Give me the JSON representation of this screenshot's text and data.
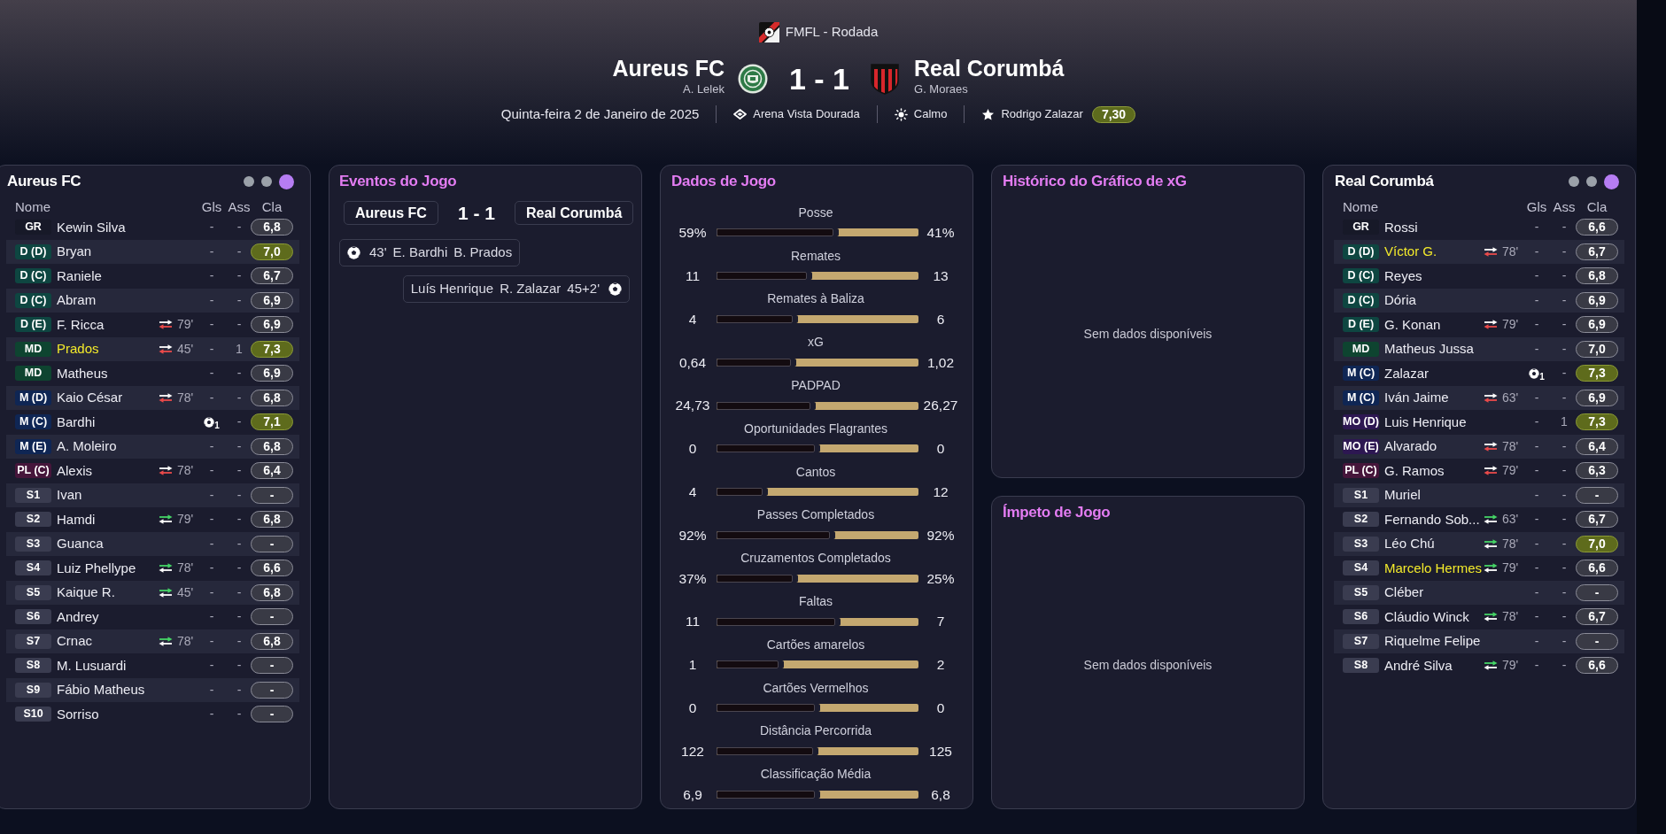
{
  "header": {
    "competition": "FMFL - Rodada",
    "home": {
      "name": "Aureus FC",
      "manager": "A. Lelek"
    },
    "score": "1 - 1",
    "away": {
      "name": "Real Corumbá",
      "manager": "G. Moraes"
    },
    "date": "Quinta-feira 2 de Janeiro de 2025",
    "stadium": "Arena Vista Dourada",
    "weather": "Calmo",
    "player_of_the_match": {
      "name": "Rodrigo Zalazar",
      "rating": "7,30"
    }
  },
  "home_lineup": {
    "title": "Aureus FC",
    "view_dots": [
      {
        "selected": false
      },
      {
        "selected": false
      },
      {
        "selected": true
      }
    ],
    "columns": [
      "Nome",
      "Gls",
      "Ass",
      "Cla"
    ],
    "players": [
      {
        "position": "GR",
        "color": "#171928",
        "name": "Kewin Silva",
        "highlighted": false,
        "goals": "-",
        "goal_icon": false,
        "assists": "-",
        "rating": "6,8",
        "top_rating": false
      },
      {
        "position": "D (D)",
        "color": "#0e4641",
        "name": "Bryan",
        "highlighted": false,
        "goals": "-",
        "goal_icon": false,
        "assists": "-",
        "rating": "7,0",
        "top_rating": true
      },
      {
        "position": "D (C)",
        "color": "#0e4641",
        "name": "Raniele",
        "highlighted": false,
        "goals": "-",
        "goal_icon": false,
        "assists": "-",
        "rating": "6,7",
        "top_rating": false
      },
      {
        "position": "D (C)",
        "color": "#0e4641",
        "name": "Abram",
        "highlighted": false,
        "goals": "-",
        "goal_icon": false,
        "assists": "-",
        "rating": "6,9",
        "top_rating": false
      },
      {
        "position": "D (E)",
        "color": "#0e4641",
        "name": "F. Ricca",
        "highlighted": false,
        "sub": {
          "kind": "off",
          "minute": "79'"
        },
        "goals": "-",
        "goal_icon": false,
        "assists": "-",
        "rating": "6,9",
        "top_rating": false
      },
      {
        "position": "MD",
        "color": "#0e4430",
        "name": "Prados",
        "highlighted": true,
        "sub": {
          "kind": "off",
          "minute": "45'"
        },
        "goals": "-",
        "goal_icon": false,
        "assists": "1",
        "rating": "7,3",
        "top_rating": true
      },
      {
        "position": "MD",
        "color": "#0e4430",
        "name": "Matheus",
        "highlighted": false,
        "goals": "-",
        "goal_icon": false,
        "assists": "-",
        "rating": "6,9",
        "top_rating": false
      },
      {
        "position": "M (D)",
        "color": "#0f2654",
        "name": "Kaio César",
        "highlighted": false,
        "sub": {
          "kind": "off",
          "minute": "78'"
        },
        "goals": "-",
        "goal_icon": false,
        "assists": "-",
        "rating": "6,8",
        "top_rating": false
      },
      {
        "position": "M (C)",
        "color": "#0f2654",
        "name": "Bardhi",
        "highlighted": false,
        "goals": "1",
        "goal_icon": true,
        "assists": "-",
        "rating": "7,1",
        "top_rating": true
      },
      {
        "position": "M (E)",
        "color": "#0f2654",
        "name": "A. Moleiro",
        "highlighted": false,
        "goals": "-",
        "goal_icon": false,
        "assists": "-",
        "rating": "6,8",
        "top_rating": false
      },
      {
        "position": "PL (C)",
        "color": "#46163b",
        "name": "Alexis",
        "highlighted": false,
        "sub": {
          "kind": "off",
          "minute": "78'"
        },
        "goals": "-",
        "goal_icon": false,
        "assists": "-",
        "rating": "6,4",
        "top_rating": false
      },
      {
        "position": "S1",
        "color": "#3a3c50",
        "name": "Ivan",
        "highlighted": false,
        "goals": "-",
        "goal_icon": false,
        "assists": "-",
        "rating": "-",
        "top_rating": false
      },
      {
        "position": "S2",
        "color": "#3a3c50",
        "name": "Hamdi",
        "highlighted": false,
        "sub": {
          "kind": "on",
          "minute": "79'"
        },
        "goals": "-",
        "goal_icon": false,
        "assists": "-",
        "rating": "6,8",
        "top_rating": false
      },
      {
        "position": "S3",
        "color": "#3a3c50",
        "name": "Guanca",
        "highlighted": false,
        "goals": "-",
        "goal_icon": false,
        "assists": "-",
        "rating": "-",
        "top_rating": false
      },
      {
        "position": "S4",
        "color": "#3a3c50",
        "name": "Luiz Phellype",
        "highlighted": false,
        "sub": {
          "kind": "on",
          "minute": "78'"
        },
        "goals": "-",
        "goal_icon": false,
        "assists": "-",
        "rating": "6,6",
        "top_rating": false
      },
      {
        "position": "S5",
        "color": "#3a3c50",
        "name": "Kaique R.",
        "highlighted": false,
        "sub": {
          "kind": "on",
          "minute": "45'"
        },
        "goals": "-",
        "goal_icon": false,
        "assists": "-",
        "rating": "6,8",
        "top_rating": false
      },
      {
        "position": "S6",
        "color": "#3a3c50",
        "name": "Andrey",
        "highlighted": false,
        "goals": "-",
        "goal_icon": false,
        "assists": "-",
        "rating": "-",
        "top_rating": false
      },
      {
        "position": "S7",
        "color": "#3a3c50",
        "name": "Crnac",
        "highlighted": false,
        "sub": {
          "kind": "on",
          "minute": "78'"
        },
        "goals": "-",
        "goal_icon": false,
        "assists": "-",
        "rating": "6,8",
        "top_rating": false
      },
      {
        "position": "S8",
        "color": "#3a3c50",
        "name": "M. Lusuardi",
        "highlighted": false,
        "goals": "-",
        "goal_icon": false,
        "assists": "-",
        "rating": "-",
        "top_rating": false
      },
      {
        "position": "S9",
        "color": "#3a3c50",
        "name": "Fábio Matheus",
        "highlighted": false,
        "goals": "-",
        "goal_icon": false,
        "assists": "-",
        "rating": "-",
        "top_rating": false
      },
      {
        "position": "S10",
        "color": "#3a3c50",
        "name": "Sorriso",
        "highlighted": false,
        "goals": "-",
        "goal_icon": false,
        "assists": "-",
        "rating": "-",
        "top_rating": false
      }
    ]
  },
  "events": {
    "title": "Eventos do Jogo",
    "home_team": "Aureus FC",
    "score": "1 - 1",
    "away_team": "Real Corumbá",
    "items": [
      {
        "kind": "goal",
        "right_aligned": false,
        "minute": "43'",
        "scorer": "E. Bardhi",
        "assist": "B. Prados"
      },
      {
        "kind": "goal",
        "right_aligned": true,
        "minute": "45+2'",
        "scorer": "R. Zalazar",
        "assist": "Luís Henrique"
      }
    ]
  },
  "match_stats": {
    "title": "Dados de Jogo",
    "stats": [
      {
        "label": "Posse",
        "home": "59%",
        "away": "41%",
        "level": 0.59
      },
      {
        "label": "Remates",
        "home": "11",
        "away": "13",
        "level": 0.46
      },
      {
        "label": "Remates à Baliza",
        "home": "4",
        "away": "6",
        "level": 0.39
      },
      {
        "label": "xG",
        "home": "0,64",
        "away": "1,02",
        "level": 0.38
      },
      {
        "label": "PADPAD",
        "home": "24,73",
        "away": "26,27",
        "level": 0.48
      },
      {
        "label": "Oportunidades Flagrantes",
        "home": "0",
        "away": "0",
        "level": 0.5
      },
      {
        "label": "Cantos",
        "home": "4",
        "away": "12",
        "level": 0.24
      },
      {
        "label": "Passes Completados",
        "home": "92%",
        "away": "92%",
        "level": 0.575
      },
      {
        "label": "Cruzamentos Completados",
        "home": "37%",
        "away": "25%",
        "level": 0.39
      },
      {
        "label": "Faltas",
        "home": "11",
        "away": "7",
        "level": 0.6
      },
      {
        "label": "Cartões amarelos",
        "home": "1",
        "away": "2",
        "level": 0.32
      },
      {
        "label": "Cartões Vermelhos",
        "home": "0",
        "away": "0",
        "level": 0.5
      },
      {
        "label": "Distância Percorrida",
        "home": "122",
        "away": "125",
        "level": 0.49
      },
      {
        "label": "Classificação Média",
        "home": "6,9",
        "away": "6,8",
        "level": 0.5
      }
    ]
  },
  "xg_history": {
    "title": "Histórico do Gráfico de xG",
    "empty_text": "Sem dados disponíveis"
  },
  "momentum": {
    "title": "Ímpeto de Jogo",
    "empty_text": "Sem dados disponíveis"
  },
  "away_lineup": {
    "title": "Real Corumbá",
    "view_dots": [
      {
        "selected": false
      },
      {
        "selected": false
      },
      {
        "selected": true
      }
    ],
    "columns": [
      "Nome",
      "Gls",
      "Ass",
      "Cla"
    ],
    "players": [
      {
        "position": "GR",
        "color": "#171928",
        "name": "Rossi",
        "highlighted": false,
        "goals": "-",
        "goal_icon": false,
        "assists": "-",
        "rating": "6,6",
        "top_rating": false
      },
      {
        "position": "D (D)",
        "color": "#0e4641",
        "name": "Víctor G.",
        "highlighted": true,
        "sub": {
          "kind": "off",
          "minute": "78'"
        },
        "goals": "-",
        "goal_icon": false,
        "assists": "-",
        "rating": "6,7",
        "top_rating": false
      },
      {
        "position": "D (C)",
        "color": "#0e4641",
        "name": "Reyes",
        "highlighted": false,
        "goals": "-",
        "goal_icon": false,
        "assists": "-",
        "rating": "6,8",
        "top_rating": false
      },
      {
        "position": "D (C)",
        "color": "#0e4641",
        "name": "Dória",
        "highlighted": false,
        "goals": "-",
        "goal_icon": false,
        "assists": "-",
        "rating": "6,9",
        "top_rating": false
      },
      {
        "position": "D (E)",
        "color": "#0e4641",
        "name": "G. Konan",
        "highlighted": false,
        "sub": {
          "kind": "off",
          "minute": "79'"
        },
        "goals": "-",
        "goal_icon": false,
        "assists": "-",
        "rating": "6,9",
        "top_rating": false
      },
      {
        "position": "MD",
        "color": "#0e4430",
        "name": "Matheus Jussa",
        "highlighted": false,
        "goals": "-",
        "goal_icon": false,
        "assists": "-",
        "rating": "7,0",
        "top_rating": false
      },
      {
        "position": "M (C)",
        "color": "#0f2654",
        "name": "Zalazar",
        "highlighted": false,
        "goals": "1",
        "goal_icon": true,
        "assists": "-",
        "rating": "7,3",
        "top_rating": true
      },
      {
        "position": "M (C)",
        "color": "#0f2654",
        "name": "Iván Jaime",
        "highlighted": false,
        "sub": {
          "kind": "off",
          "minute": "63'"
        },
        "goals": "-",
        "goal_icon": false,
        "assists": "-",
        "rating": "6,9",
        "top_rating": false
      },
      {
        "position": "MO (D)",
        "color": "#2d1752",
        "name": "Luis Henrique",
        "highlighted": false,
        "goals": "-",
        "goal_icon": false,
        "assists": "1",
        "rating": "7,3",
        "top_rating": true
      },
      {
        "position": "MO (E)",
        "color": "#2d1752",
        "name": "Alvarado",
        "highlighted": false,
        "sub": {
          "kind": "off",
          "minute": "78'"
        },
        "goals": "-",
        "goal_icon": false,
        "assists": "-",
        "rating": "6,4",
        "top_rating": false
      },
      {
        "position": "PL (C)",
        "color": "#46163b",
        "name": "G. Ramos",
        "highlighted": false,
        "sub": {
          "kind": "off",
          "minute": "79'"
        },
        "goals": "-",
        "goal_icon": false,
        "assists": "-",
        "rating": "6,3",
        "top_rating": false
      },
      {
        "position": "S1",
        "color": "#3a3c50",
        "name": "Muriel",
        "highlighted": false,
        "goals": "-",
        "goal_icon": false,
        "assists": "-",
        "rating": "-",
        "top_rating": false
      },
      {
        "position": "S2",
        "color": "#3a3c50",
        "name": "Fernando Sob...",
        "highlighted": false,
        "sub": {
          "kind": "on",
          "minute": "63'"
        },
        "goals": "-",
        "goal_icon": false,
        "assists": "-",
        "rating": "6,7",
        "top_rating": false
      },
      {
        "position": "S3",
        "color": "#3a3c50",
        "name": "Léo Chú",
        "highlighted": false,
        "sub": {
          "kind": "on",
          "minute": "78'"
        },
        "goals": "-",
        "goal_icon": false,
        "assists": "-",
        "rating": "7,0",
        "top_rating": true
      },
      {
        "position": "S4",
        "color": "#3a3c50",
        "name": "Marcelo Hermes",
        "highlighted": true,
        "sub": {
          "kind": "on",
          "minute": "79'"
        },
        "goals": "-",
        "goal_icon": false,
        "assists": "-",
        "rating": "6,6",
        "top_rating": false
      },
      {
        "position": "S5",
        "color": "#3a3c50",
        "name": "Cléber",
        "highlighted": false,
        "goals": "-",
        "goal_icon": false,
        "assists": "-",
        "rating": "-",
        "top_rating": false
      },
      {
        "position": "S6",
        "color": "#3a3c50",
        "name": "Cláudio Winck",
        "highlighted": false,
        "sub": {
          "kind": "on",
          "minute": "78'"
        },
        "goals": "-",
        "goal_icon": false,
        "assists": "-",
        "rating": "6,7",
        "top_rating": false
      },
      {
        "position": "S7",
        "color": "#3a3c50",
        "name": "Riquelme Felipe",
        "highlighted": false,
        "goals": "-",
        "goal_icon": false,
        "assists": "-",
        "rating": "-",
        "top_rating": false
      },
      {
        "position": "S8",
        "color": "#3a3c50",
        "name": "André Silva",
        "highlighted": false,
        "sub": {
          "kind": "on",
          "minute": "79'"
        },
        "goals": "-",
        "goal_icon": false,
        "assists": "-",
        "rating": "6,6",
        "top_rating": false
      }
    ]
  }
}
